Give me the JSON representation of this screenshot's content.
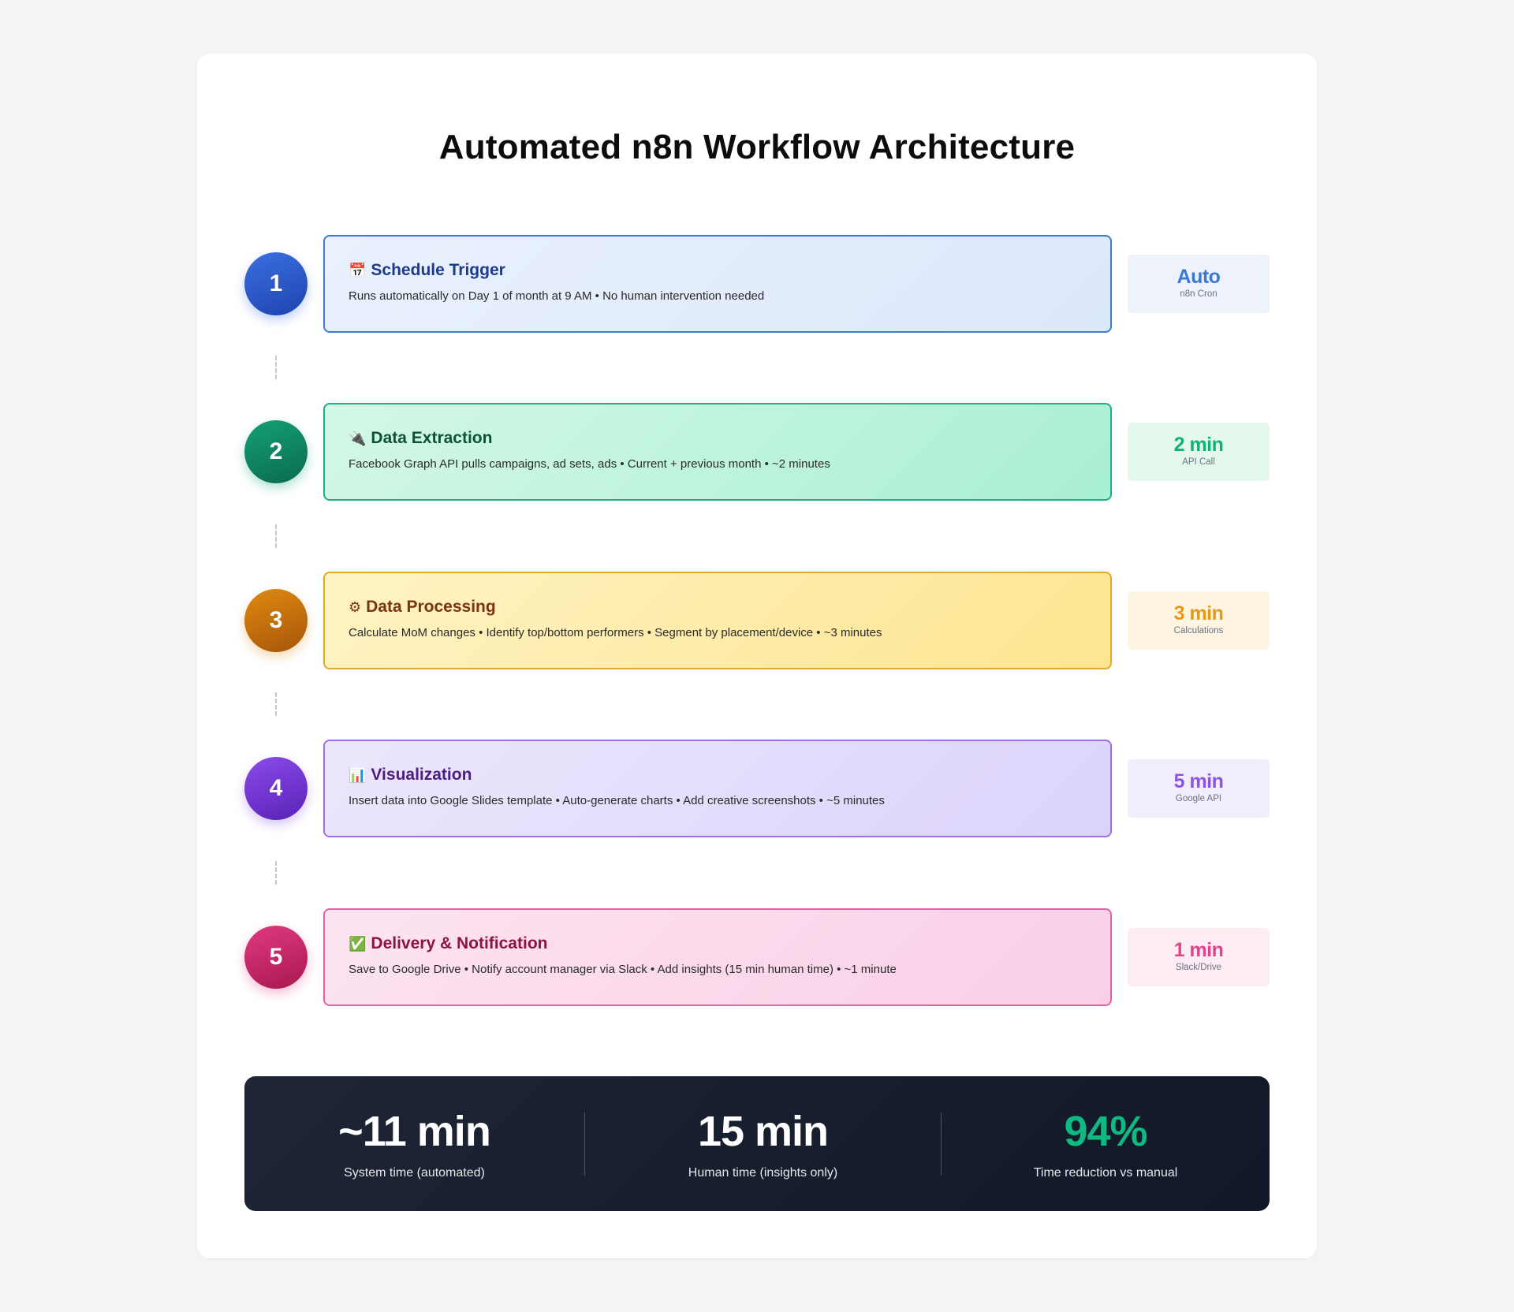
{
  "title": "Automated n8n Workflow Architecture",
  "steps": [
    {
      "number": "1",
      "icon": "📅",
      "title": "Schedule Trigger",
      "description": "Runs automatically on Day 1 of month at 9 AM • No human intervention needed",
      "metric_value": "Auto",
      "metric_label": "n8n Cron",
      "colors": {
        "circle_a": "#3b6fe0",
        "circle_b": "#1e44b0",
        "border": "#3b7bd0",
        "bg_a": "#eaf1fd",
        "bg_b": "#dce8fb",
        "title": "#1e3a8a",
        "metric_bg": "#eef2fb",
        "metric_text": "#3b78d8"
      }
    },
    {
      "number": "2",
      "icon": "🔌",
      "title": "Data Extraction",
      "description": "Facebook Graph API pulls campaigns, ad sets, ads • Current + previous month • ~2 minutes",
      "metric_value": "2 min",
      "metric_label": "API Call",
      "colors": {
        "circle_a": "#14a077",
        "circle_b": "#0b6a4f",
        "border": "#1fb080",
        "bg_a": "#d4f8e6",
        "bg_b": "#a9f0d2",
        "title": "#0b5238",
        "metric_bg": "#e4f8ee",
        "metric_text": "#10b27a"
      }
    },
    {
      "number": "3",
      "icon": "⚙",
      "title": "Data Processing",
      "description": "Calculate MoM changes • Identify top/bottom performers • Segment by placement/device • ~3 minutes",
      "metric_value": "3 min",
      "metric_label": "Calculations",
      "colors": {
        "circle_a": "#e08a10",
        "circle_b": "#a6550a",
        "border": "#e2a92a",
        "bg_a": "#fef3c4",
        "bg_b": "#fde590",
        "title": "#7a3410",
        "metric_bg": "#fdf4e2",
        "metric_text": "#e39a18"
      }
    },
    {
      "number": "4",
      "icon": "📊",
      "title": "Visualization",
      "description": "Insert data into Google Slides template • Auto-generate charts • Add creative screenshots • ~5 minutes",
      "metric_value": "5 min",
      "metric_label": "Google API",
      "colors": {
        "circle_a": "#8a4ce8",
        "circle_b": "#5a22b8",
        "border": "#9f6fe0",
        "bg_a": "#ece7fc",
        "bg_b": "#dcd3fb",
        "title": "#4c1d85",
        "metric_bg": "#f1edfb",
        "metric_text": "#8b55e0"
      }
    },
    {
      "number": "5",
      "icon": "✅",
      "title": "Delivery & Notification",
      "description": "Save to Google Drive • Notify account manager via Slack • Add insights (15 min human time) • ~1 minute",
      "metric_value": "1 min",
      "metric_label": "Slack/Drive",
      "colors": {
        "circle_a": "#e03a80",
        "circle_b": "#a81850",
        "border": "#e063a4",
        "bg_a": "#fde4f1",
        "bg_b": "#f9cfe6",
        "title": "#8a1540",
        "metric_bg": "#fdecf4",
        "metric_text": "#e0448a"
      }
    }
  ],
  "summary": {
    "system_time_value": "~11 min",
    "system_time_label": "System time (automated)",
    "human_time_value": "15 min",
    "human_time_label": "Human time (insights only)",
    "reduction_value": "94%",
    "reduction_label": "Time reduction vs manual",
    "reduction_color": "#10b981"
  }
}
